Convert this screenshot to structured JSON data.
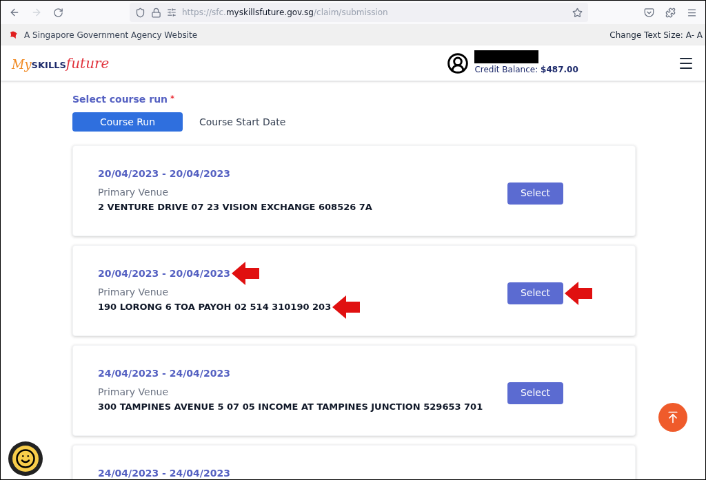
{
  "browser": {
    "url_prefix": "https://sfc.",
    "url_domain": "myskillsfuture.gov.sg",
    "url_path": "/claim/submission"
  },
  "gov_banner": {
    "text": "A Singapore Government Agency Website",
    "text_size": "Change Text Size: A- A"
  },
  "header": {
    "logo": [
      "My",
      "SKILLS",
      "future"
    ],
    "credit_label": "Credit Balance:",
    "credit_value": "$487.00"
  },
  "section": {
    "label": "Select course run",
    "required_mark": "*"
  },
  "tabs": [
    {
      "label": "Course Run",
      "selected": true
    },
    {
      "label": "Course Start Date",
      "selected": false
    }
  ],
  "course_runs": [
    {
      "dates": "20/04/2023 - 20/04/2023",
      "venue_label": "Primary Venue",
      "venue": "2 VENTURE DRIVE 07 23 VISION EXCHANGE 608526 7A",
      "button": "Select",
      "highlighted": false
    },
    {
      "dates": "20/04/2023 - 20/04/2023",
      "venue_label": "Primary Venue",
      "venue": "190 LORONG 6 TOA PAYOH 02 514 310190 203",
      "button": "Select",
      "highlighted": true
    },
    {
      "dates": "24/04/2023 - 24/04/2023",
      "venue_label": "Primary Venue",
      "venue": "300 TAMPINES AVENUE 5 07 05 INCOME AT TAMPINES JUNCTION 529653 701",
      "button": "Select",
      "highlighted": false
    },
    {
      "dates": "24/04/2023 - 24/04/2023"
    }
  ]
}
